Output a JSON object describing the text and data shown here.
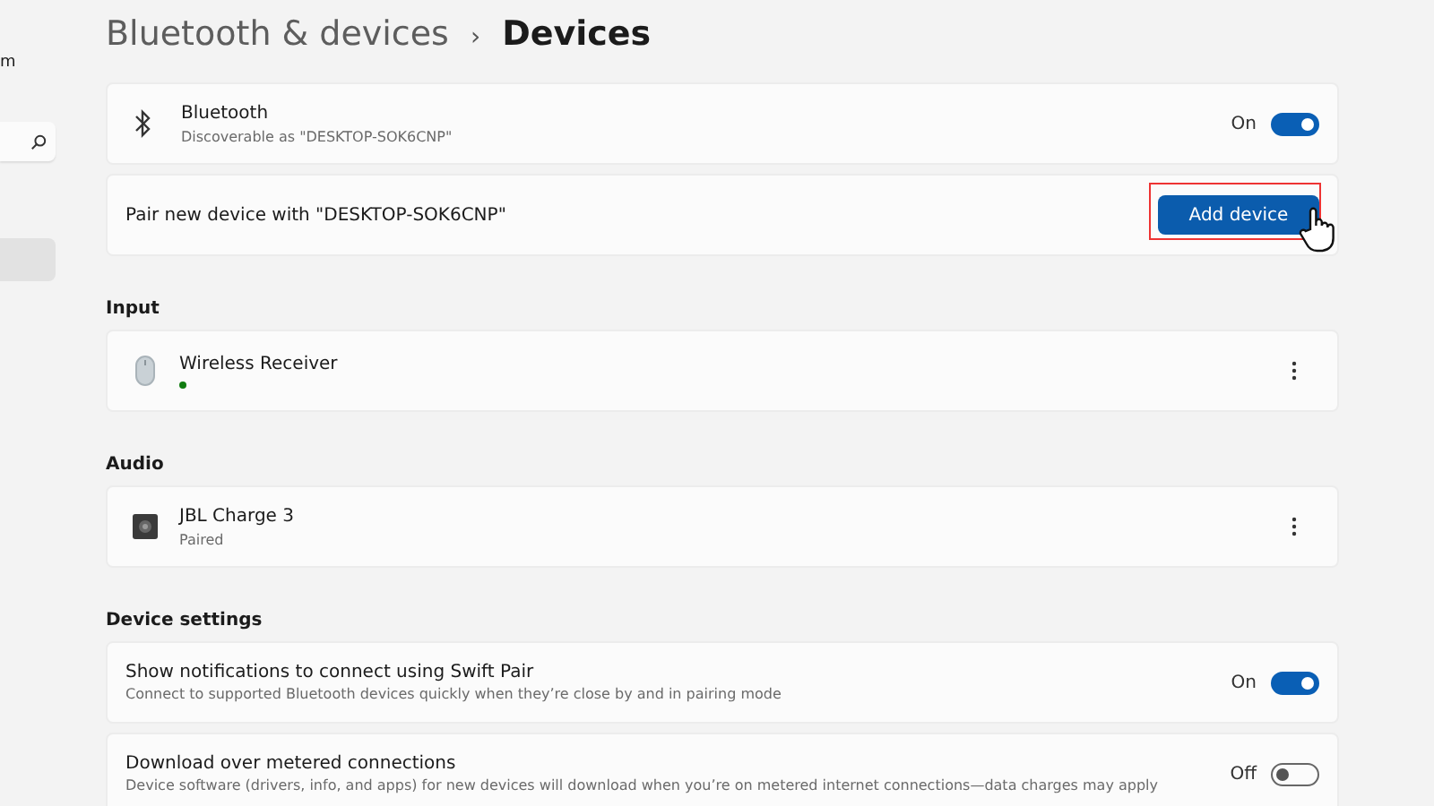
{
  "sidebar": {
    "label_fragment": "m",
    "items": [
      {
        "selected": true
      }
    ]
  },
  "breadcrumb": {
    "parent": "Bluetooth & devices",
    "separator": "›",
    "current": "Devices"
  },
  "bluetooth": {
    "title": "Bluetooth",
    "subtitle": "Discoverable as \"DESKTOP-SOK6CNP\"",
    "state_label": "On",
    "on": true
  },
  "pair": {
    "text": "Pair new device with \"DESKTOP-SOK6CNP\"",
    "button": "Add device",
    "highlighted": true
  },
  "sections": [
    {
      "heading": "Input",
      "devices": [
        {
          "kind": "mouse",
          "name": "Wireless Receiver",
          "connected": true
        }
      ]
    },
    {
      "heading": "Audio",
      "devices": [
        {
          "kind": "speaker",
          "name": "JBL Charge 3",
          "status": "Paired",
          "connected": false
        }
      ]
    }
  ],
  "device_settings": {
    "heading": "Device settings",
    "items": [
      {
        "title": "Show notifications to connect using Swift Pair",
        "description": "Connect to supported Bluetooth devices quickly when they’re close by and in pairing mode",
        "state_label": "On",
        "on": true
      },
      {
        "title": "Download over metered connections",
        "description": "Device software (drivers, info, and apps) for new devices will download when you’re on metered internet connections—data charges may apply",
        "state_label": "Off",
        "on": false
      }
    ]
  }
}
